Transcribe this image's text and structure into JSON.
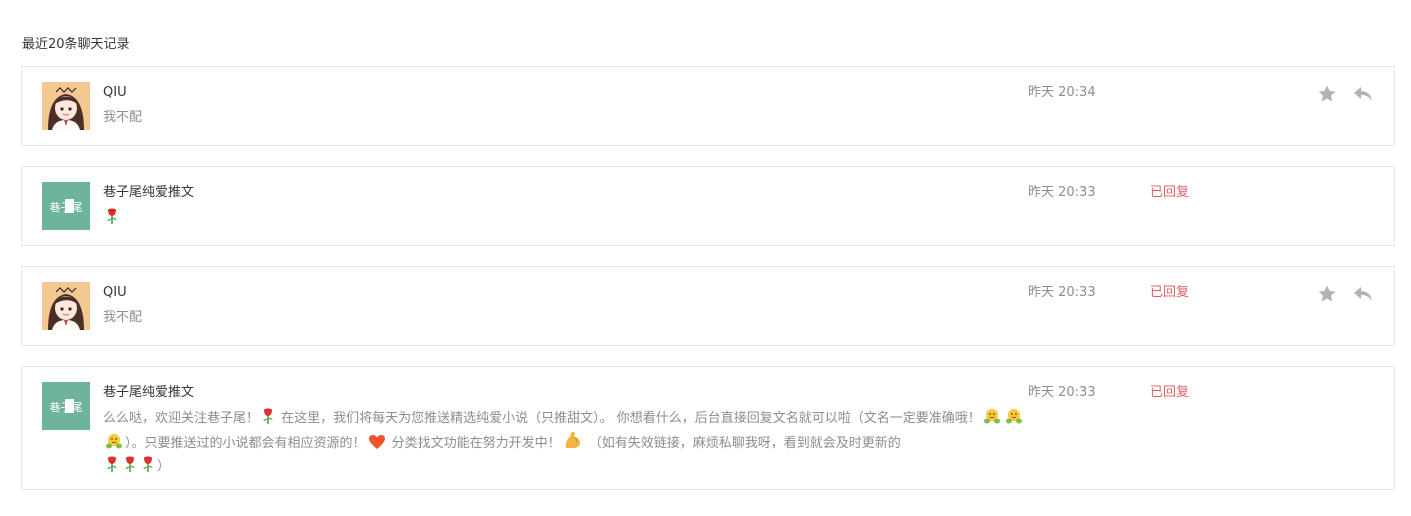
{
  "header": {
    "title": "最近20条聊天记录"
  },
  "colors": {
    "replied": "#e15f63",
    "muted": "#8d8d8d",
    "border": "#e7e7eb",
    "brand_avatar": "#6eb49b",
    "icon": "#b2b2b2"
  },
  "messages": [
    {
      "nickname": "QIU",
      "content": "我不配",
      "time": "昨天 20:34",
      "status": "",
      "avatar": "girl-avatar",
      "actions": [
        "star-icon",
        "reply-icon"
      ]
    },
    {
      "nickname": "巷子尾纯爱推文",
      "content": "",
      "time": "昨天 20:33",
      "status": "已回复",
      "avatar": "brand-avatar",
      "emoji": "rose-icon"
    },
    {
      "nickname": "QIU",
      "content": "我不配",
      "time": "昨天 20:33",
      "status": "已回复",
      "avatar": "girl-avatar",
      "actions": [
        "star-icon",
        "reply-icon"
      ]
    },
    {
      "nickname": "巷子尾纯爱推文",
      "content_parts": {
        "p1": "么么哒，欢迎关注巷子尾！",
        "p2": " 在这里，我们将每天为您推送精选纯爱小说（只推甜文）。 你想看什么，后台直接回复文名就可以啦（文名一定要准确哦！",
        "p3": "）。只要推送过的小说都会有相应资源的！",
        "p4": " 分类找文功能在努力开发中！",
        "p5": " （如有失效链接，麻烦私聊我呀，看到就会及时更新的",
        "p6": "）"
      },
      "time": "昨天 20:33",
      "status": "已回复",
      "avatar": "brand-avatar"
    }
  ],
  "brand_logo_text": "巷子尾"
}
